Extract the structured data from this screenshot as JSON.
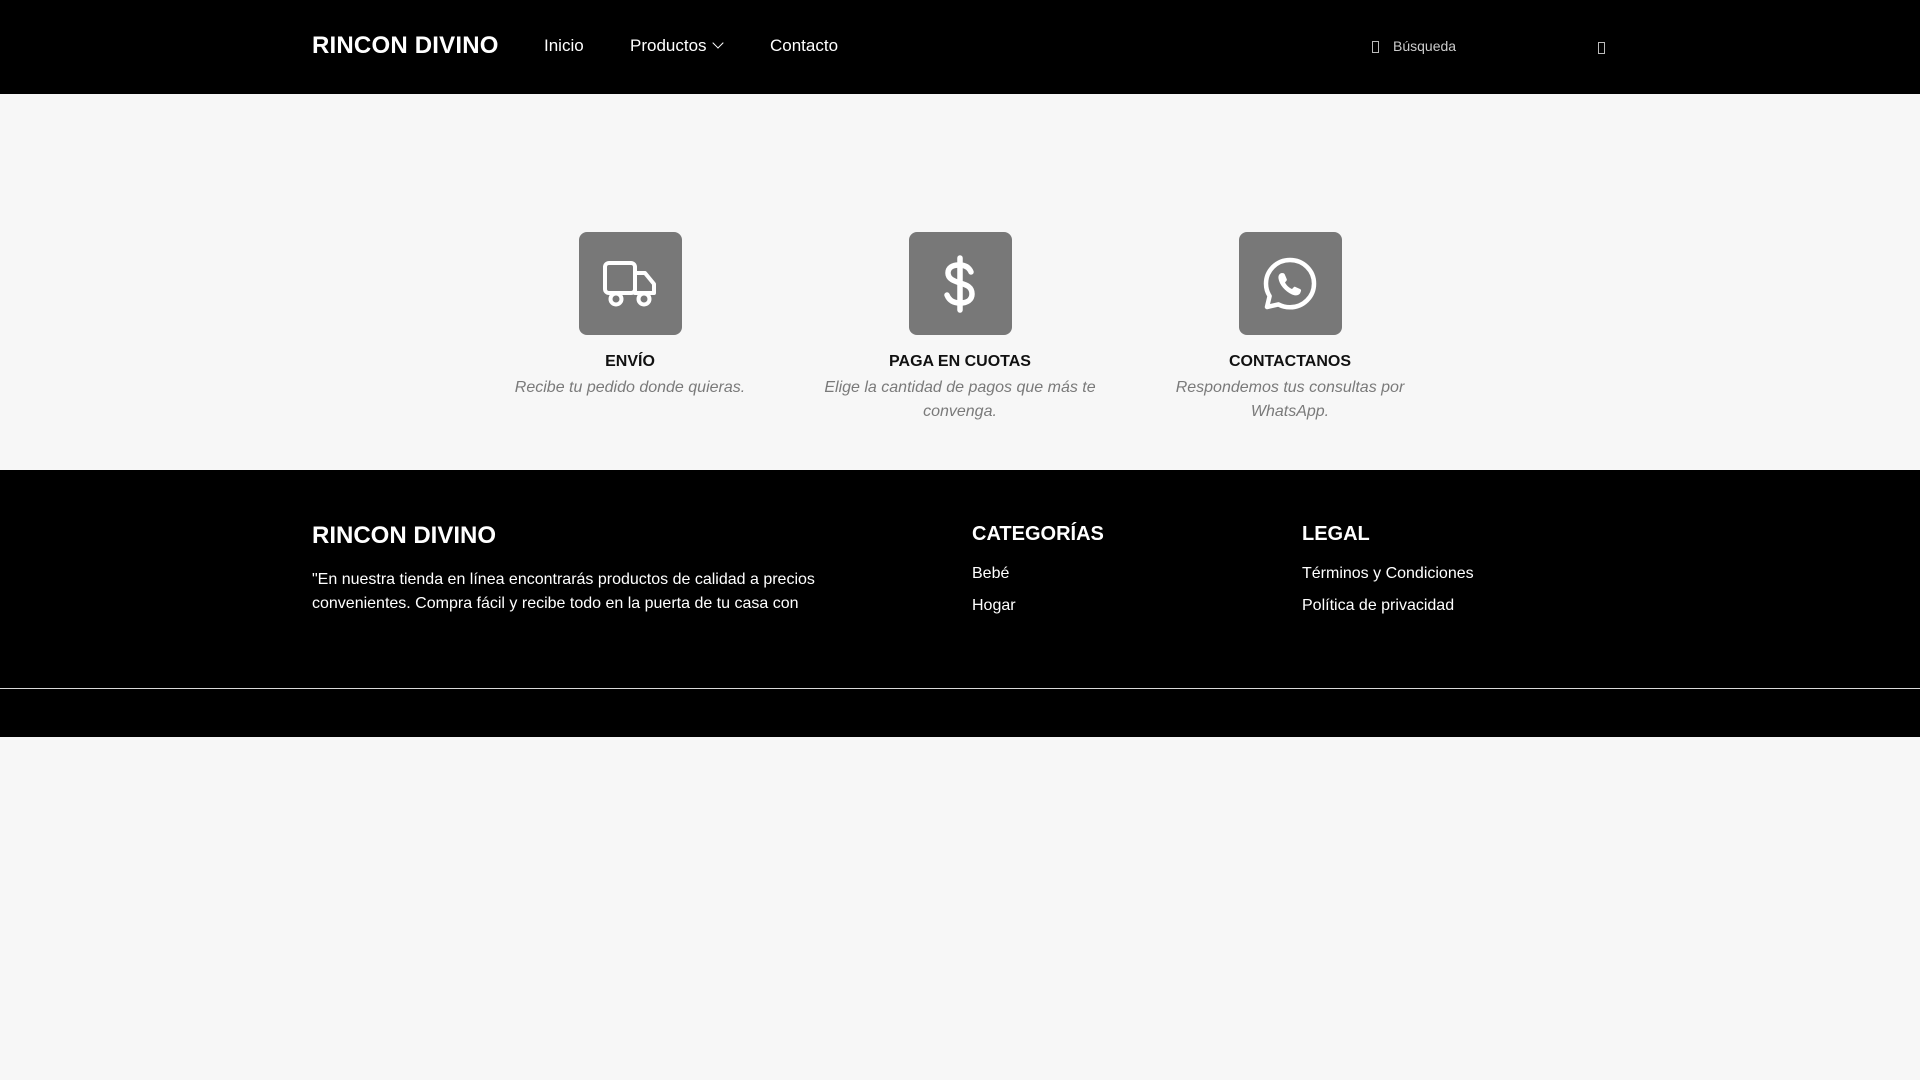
{
  "header": {
    "brand": "RINCON DIVINO",
    "nav": [
      {
        "label": "Inicio"
      },
      {
        "label": "Productos"
      },
      {
        "label": "Contacto"
      }
    ],
    "search": {
      "placeholder": "Búsqueda",
      "icon": "search-icon"
    }
  },
  "features": [
    {
      "icon": "truck-icon",
      "title": "ENVÍO",
      "desc": "Recibe tu pedido donde quieras."
    },
    {
      "icon": "dollar-icon",
      "title": "PAGA EN CUOTAS",
      "desc": "Elige la cantidad de pagos que más te convenga."
    },
    {
      "icon": "whatsapp-icon",
      "title": "CONTACTANOS",
      "desc": "Respondemos tus consultas por WhatsApp."
    }
  ],
  "footer": {
    "brand": "RINCON DIVINO",
    "description": "\"En nuestra tienda en línea encontrarás productos de calidad a precios convenientes. Compra fácil y recibe todo en la puerta de tu casa con",
    "categories": {
      "title": "CATEGORÍAS",
      "items": [
        "Bebé",
        "Hogar"
      ]
    },
    "legal": {
      "title": "LEGAL",
      "items": [
        "Términos y Condiciones",
        "Política de privacidad"
      ]
    }
  },
  "colors": {
    "header_bg": "#000000",
    "page_bg": "#f7f7f7",
    "icon_tile": "#787878",
    "muted_text": "#7a7a7a"
  }
}
